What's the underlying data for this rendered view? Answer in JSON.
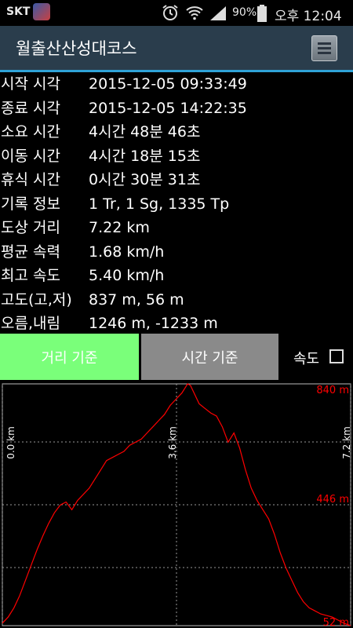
{
  "status": {
    "carrier": "SKT",
    "battery": "90%",
    "time": "오후 12:04",
    "icons": [
      "app-notification-icon",
      "alarm-icon",
      "wifi-icon",
      "signal-icon",
      "battery-icon"
    ]
  },
  "header": {
    "title": "월출산산성대코스",
    "menu_icon": "menu-icon"
  },
  "summary": [
    {
      "label": "시작 시각",
      "value": "2015-12-05 09:33:49"
    },
    {
      "label": "종료 시각",
      "value": "2015-12-05 14:22:35"
    },
    {
      "label": "소요 시간",
      "value": "4시간 48분 46초"
    },
    {
      "label": "이동 시간",
      "value": "4시간 18분 15초"
    },
    {
      "label": "휴식 시간",
      "value": "0시간 30분 31초"
    },
    {
      "label": "기록 정보",
      "value": "1 Tr, 1 Sg, 1335 Tp"
    },
    {
      "label": "도상 거리",
      "value": "7.22 km"
    },
    {
      "label": "평균 속력",
      "value": "1.68 km/h"
    },
    {
      "label": "최고 속도",
      "value": "5.40 km/h"
    },
    {
      "label": "고도(고,저)",
      "value": "837 m, 56 m"
    },
    {
      "label": "오름,내림",
      "value": "1246 m, -1233 m"
    }
  ],
  "controls": {
    "distance_basis": "거리 기준",
    "time_basis": "시간 기준",
    "speed_label": "속도",
    "speed_checked": false
  },
  "colors": {
    "accent": "#2fa3d8",
    "line": "#ff0000",
    "active_button": "#7aff7a",
    "inactive_button": "#8a8a8a"
  },
  "chart_data": {
    "type": "line",
    "x_tick_labels": [
      "0.0 km",
      "3.6 km",
      "7.2 km"
    ],
    "y_tick_labels": [
      "840 m",
      "446 m",
      "52 m"
    ],
    "xlim": [
      0,
      7.22
    ],
    "ylim": [
      52,
      840
    ],
    "grid": true,
    "x": [
      0.0,
      0.12,
      0.24,
      0.36,
      0.48,
      0.6,
      0.72,
      0.84,
      0.96,
      1.08,
      1.2,
      1.32,
      1.44,
      1.56,
      1.68,
      1.8,
      1.92,
      2.04,
      2.16,
      2.28,
      2.4,
      2.52,
      2.64,
      2.76,
      2.88,
      3.0,
      3.12,
      3.24,
      3.36,
      3.48,
      3.6,
      3.72,
      3.8,
      3.84,
      3.9,
      3.96,
      4.08,
      4.2,
      4.32,
      4.44,
      4.56,
      4.68,
      4.8,
      4.92,
      5.04,
      5.16,
      5.28,
      5.4,
      5.52,
      5.64,
      5.76,
      5.88,
      6.0,
      6.12,
      6.24,
      6.36,
      6.48,
      6.6,
      6.72,
      6.84,
      6.96,
      7.08,
      7.22
    ],
    "y": [
      60,
      80,
      110,
      150,
      200,
      250,
      300,
      345,
      385,
      420,
      445,
      455,
      430,
      460,
      480,
      500,
      530,
      560,
      590,
      600,
      610,
      620,
      640,
      650,
      660,
      680,
      700,
      720,
      740,
      770,
      790,
      810,
      830,
      840,
      835,
      815,
      775,
      760,
      745,
      735,
      700,
      650,
      680,
      630,
      560,
      500,
      460,
      430,
      400,
      350,
      290,
      240,
      200,
      160,
      130,
      110,
      100,
      90,
      85,
      80,
      70,
      60,
      52
    ]
  }
}
